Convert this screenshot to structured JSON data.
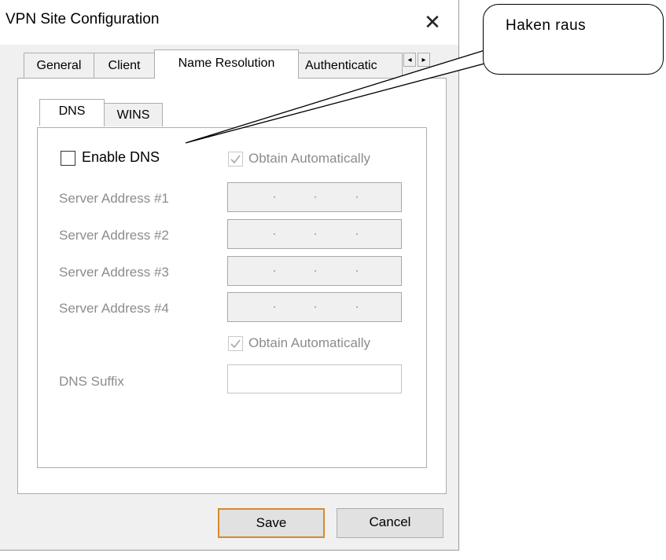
{
  "window": {
    "title": "VPN Site Configuration",
    "close_glyph": "✕"
  },
  "tabs": [
    {
      "label": "General"
    },
    {
      "label": "Client"
    },
    {
      "label": "Name Resolution",
      "active": true
    },
    {
      "label": "Authenticatic"
    }
  ],
  "tab_scroll": {
    "left": "◂",
    "right": "▸"
  },
  "inner_tabs": [
    {
      "label": "DNS",
      "active": true
    },
    {
      "label": "WINS"
    }
  ],
  "dns": {
    "enable_label": "Enable DNS",
    "enable_checked": false,
    "obtain_auto_label": "Obtain Automatically",
    "obtain_auto_checked": true,
    "servers": [
      {
        "label": "Server Address #1",
        "value": ". . ."
      },
      {
        "label": "Server Address #2",
        "value": ". . ."
      },
      {
        "label": "Server Address #3",
        "value": ". . ."
      },
      {
        "label": "Server Address #4",
        "value": ". . ."
      }
    ],
    "obtain_auto_suffix_label": "Obtain Automatically",
    "obtain_auto_suffix_checked": true,
    "suffix_label": "DNS Suffix",
    "suffix_value": ""
  },
  "buttons": {
    "save": "Save",
    "cancel": "Cancel"
  },
  "annotation": {
    "text": "Haken raus"
  },
  "colors": {
    "accent": "#d7892f",
    "backdrop": "#b07a2a",
    "disabled_text": "#8c8c8c"
  }
}
